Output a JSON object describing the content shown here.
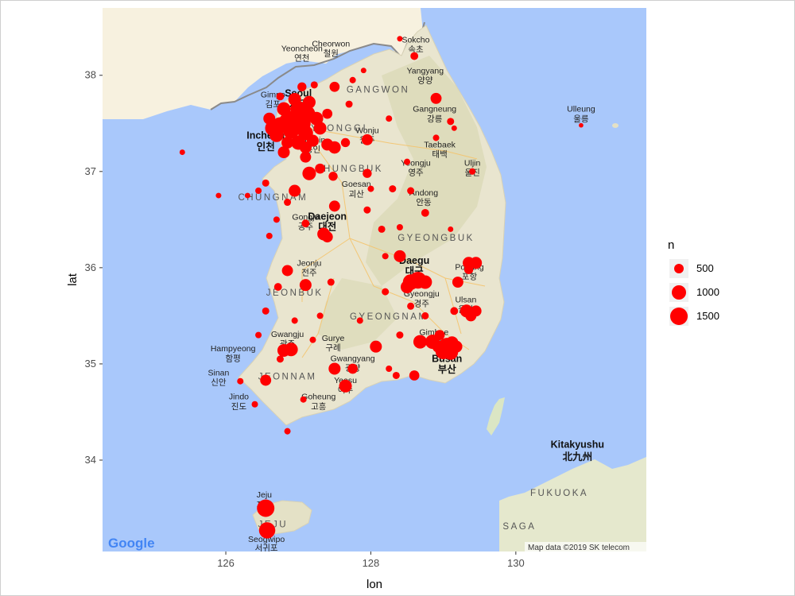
{
  "axes": {
    "xlabel": "lon",
    "ylabel": "lat",
    "x_ticks": [
      "126",
      "128",
      "130"
    ],
    "y_ticks": [
      "34",
      "35",
      "36",
      "37",
      "38"
    ],
    "xlim": [
      124.3,
      131.8
    ],
    "ylim": [
      33.05,
      38.7
    ]
  },
  "legend": {
    "title": "n",
    "entries": [
      {
        "label": "500",
        "value": 500
      },
      {
        "label": "1000",
        "value": 1000
      },
      {
        "label": "1500",
        "value": 1500
      }
    ]
  },
  "basemap": {
    "google_logo": "Google",
    "attribution": "Map data ©2019 SK telecom",
    "place_labels": [
      {
        "text": "Seoul",
        "lon": 127.0,
        "lat": 37.78,
        "bold": true
      },
      {
        "text": "서울",
        "lon": 127.0,
        "lat": 37.66,
        "bold": true
      },
      {
        "text": "Incheon",
        "lon": 126.55,
        "lat": 37.34,
        "bold": true
      },
      {
        "text": "인천",
        "lon": 126.55,
        "lat": 37.22,
        "bold": true
      },
      {
        "text": "Gimpo",
        "lon": 126.65,
        "lat": 37.77
      },
      {
        "text": "김포",
        "lon": 126.65,
        "lat": 37.67
      },
      {
        "text": "Yeoncheon",
        "lon": 127.05,
        "lat": 38.25
      },
      {
        "text": "연천",
        "lon": 127.05,
        "lat": 38.15
      },
      {
        "text": "Cheorwon",
        "lon": 127.45,
        "lat": 38.3
      },
      {
        "text": "철원",
        "lon": 127.45,
        "lat": 38.2
      },
      {
        "text": "Sokcho",
        "lon": 128.62,
        "lat": 38.34
      },
      {
        "text": "속초",
        "lon": 128.62,
        "lat": 38.24
      },
      {
        "text": "Yangyang",
        "lon": 128.75,
        "lat": 38.02
      },
      {
        "text": "양양",
        "lon": 128.75,
        "lat": 37.92
      },
      {
        "text": "Gangneung",
        "lon": 128.88,
        "lat": 37.62
      },
      {
        "text": "강릉",
        "lon": 128.88,
        "lat": 37.52
      },
      {
        "text": "Taebaek",
        "lon": 128.95,
        "lat": 37.25
      },
      {
        "text": "태백",
        "lon": 128.95,
        "lat": 37.15
      },
      {
        "text": "Wonju",
        "lon": 127.95,
        "lat": 37.4
      },
      {
        "text": "원주",
        "lon": 127.95,
        "lat": 37.3
      },
      {
        "text": "Yongin",
        "lon": 127.2,
        "lat": 37.3
      },
      {
        "text": "용인",
        "lon": 127.2,
        "lat": 37.2
      },
      {
        "text": "Yeongju",
        "lon": 128.62,
        "lat": 37.06
      },
      {
        "text": "영주",
        "lon": 128.62,
        "lat": 36.96
      },
      {
        "text": "Uljin",
        "lon": 129.4,
        "lat": 37.06
      },
      {
        "text": "울진",
        "lon": 129.4,
        "lat": 36.96
      },
      {
        "text": "Goesan",
        "lon": 127.8,
        "lat": 36.84
      },
      {
        "text": "괴산",
        "lon": 127.8,
        "lat": 36.74
      },
      {
        "text": "Andong",
        "lon": 128.73,
        "lat": 36.75
      },
      {
        "text": "안동",
        "lon": 128.73,
        "lat": 36.65
      },
      {
        "text": "Daejeon",
        "lon": 127.4,
        "lat": 36.5,
        "bold": true
      },
      {
        "text": "대전",
        "lon": 127.4,
        "lat": 36.39,
        "bold": true
      },
      {
        "text": "Gongju",
        "lon": 127.1,
        "lat": 36.5
      },
      {
        "text": "공주",
        "lon": 127.1,
        "lat": 36.4
      },
      {
        "text": "Daegu",
        "lon": 128.6,
        "lat": 36.04,
        "bold": true
      },
      {
        "text": "대구",
        "lon": 128.6,
        "lat": 35.93,
        "bold": true
      },
      {
        "text": "Pohang",
        "lon": 129.36,
        "lat": 35.98
      },
      {
        "text": "포항",
        "lon": 129.36,
        "lat": 35.88
      },
      {
        "text": "Ulsan",
        "lon": 129.31,
        "lat": 35.64
      },
      {
        "text": "울산",
        "lon": 129.31,
        "lat": 35.54
      },
      {
        "text": "Jeonju",
        "lon": 127.15,
        "lat": 36.02
      },
      {
        "text": "전주",
        "lon": 127.15,
        "lat": 35.92
      },
      {
        "text": "Gyeongju",
        "lon": 128.7,
        "lat": 35.7
      },
      {
        "text": "경주",
        "lon": 128.7,
        "lat": 35.6
      },
      {
        "text": "Gimhae",
        "lon": 128.87,
        "lat": 35.3
      },
      {
        "text": "김해",
        "lon": 128.87,
        "lat": 35.2
      },
      {
        "text": "Busan",
        "lon": 129.05,
        "lat": 35.02,
        "bold": true
      },
      {
        "text": "부산",
        "lon": 129.05,
        "lat": 34.91,
        "bold": true
      },
      {
        "text": "Gwangju",
        "lon": 126.85,
        "lat": 35.28
      },
      {
        "text": "광주",
        "lon": 126.85,
        "lat": 35.18
      },
      {
        "text": "Gurye",
        "lon": 127.48,
        "lat": 35.24
      },
      {
        "text": "구례",
        "lon": 127.48,
        "lat": 35.14
      },
      {
        "text": "Hampyeong",
        "lon": 126.1,
        "lat": 35.13
      },
      {
        "text": "함평",
        "lon": 126.1,
        "lat": 35.03
      },
      {
        "text": "Gwangyang",
        "lon": 127.75,
        "lat": 35.03
      },
      {
        "text": "광양",
        "lon": 127.75,
        "lat": 34.93
      },
      {
        "text": "Sinan",
        "lon": 125.9,
        "lat": 34.88
      },
      {
        "text": "신안",
        "lon": 125.9,
        "lat": 34.78
      },
      {
        "text": "Yeosu",
        "lon": 127.65,
        "lat": 34.8
      },
      {
        "text": "여수",
        "lon": 127.65,
        "lat": 34.7
      },
      {
        "text": "Jindo",
        "lon": 126.18,
        "lat": 34.63
      },
      {
        "text": "진도",
        "lon": 126.18,
        "lat": 34.53
      },
      {
        "text": "Goheung",
        "lon": 127.28,
        "lat": 34.63
      },
      {
        "text": "고흥",
        "lon": 127.28,
        "lat": 34.53
      },
      {
        "text": "Jeju",
        "lon": 126.53,
        "lat": 33.61
      },
      {
        "text": "제주",
        "lon": 126.53,
        "lat": 33.51
      },
      {
        "text": "Seogwipo",
        "lon": 126.56,
        "lat": 33.15
      },
      {
        "text": "서귀포",
        "lon": 126.56,
        "lat": 33.06
      },
      {
        "text": "Ulleung",
        "lon": 130.9,
        "lat": 37.62
      },
      {
        "text": "울릉",
        "lon": 130.9,
        "lat": 37.52
      },
      {
        "text": "Kitakyushu",
        "lon": 130.85,
        "lat": 34.13,
        "bold": true
      },
      {
        "text": "北九州",
        "lon": 130.85,
        "lat": 34.0,
        "bold": true
      }
    ],
    "province_labels": [
      {
        "text": "GANGWON",
        "lon": 128.1,
        "lat": 37.82
      },
      {
        "text": "GYEONGGI",
        "lon": 127.5,
        "lat": 37.42
      },
      {
        "text": "CHUNGBUK",
        "lon": 127.7,
        "lat": 37.0
      },
      {
        "text": "CHUNGNAM",
        "lon": 126.65,
        "lat": 36.7
      },
      {
        "text": "GYEONGBUK",
        "lon": 128.9,
        "lat": 36.28
      },
      {
        "text": "JEONBUK",
        "lon": 126.95,
        "lat": 35.71
      },
      {
        "text": "GYEONGNAM",
        "lon": 128.25,
        "lat": 35.46
      },
      {
        "text": "JEONNAM",
        "lon": 126.85,
        "lat": 34.84
      },
      {
        "text": "JEJU",
        "lon": 126.65,
        "lat": 33.3
      },
      {
        "text": "FUKUOKA",
        "lon": 130.6,
        "lat": 33.63
      },
      {
        "text": "SAGA",
        "lon": 130.05,
        "lat": 33.28
      }
    ]
  },
  "chart_data": {
    "type": "scatter",
    "xlabel": "lon",
    "ylabel": "lat",
    "xlim": [
      124.3,
      131.8
    ],
    "ylim": [
      33.05,
      38.7
    ],
    "size_variable": "n",
    "size_breaks": [
      500,
      1000,
      1500
    ],
    "color": "#ff0000",
    "points": [
      {
        "lon": 126.95,
        "lat": 37.55,
        "n": 1500
      },
      {
        "lon": 127.05,
        "lat": 37.5,
        "n": 1500
      },
      {
        "lon": 126.85,
        "lat": 37.52,
        "n": 1400
      },
      {
        "lon": 126.75,
        "lat": 37.48,
        "n": 1300
      },
      {
        "lon": 127.12,
        "lat": 37.6,
        "n": 1300
      },
      {
        "lon": 127.0,
        "lat": 37.65,
        "n": 1200
      },
      {
        "lon": 126.9,
        "lat": 37.42,
        "n": 1200
      },
      {
        "lon": 127.1,
        "lat": 37.4,
        "n": 1100
      },
      {
        "lon": 126.65,
        "lat": 37.45,
        "n": 1200
      },
      {
        "lon": 126.7,
        "lat": 37.38,
        "n": 1000
      },
      {
        "lon": 127.0,
        "lat": 37.3,
        "n": 1000
      },
      {
        "lon": 126.8,
        "lat": 37.65,
        "n": 900
      },
      {
        "lon": 127.15,
        "lat": 37.72,
        "n": 800
      },
      {
        "lon": 127.25,
        "lat": 37.55,
        "n": 900
      },
      {
        "lon": 126.95,
        "lat": 37.75,
        "n": 800
      },
      {
        "lon": 126.6,
        "lat": 37.55,
        "n": 700
      },
      {
        "lon": 127.3,
        "lat": 37.45,
        "n": 800
      },
      {
        "lon": 127.2,
        "lat": 37.32,
        "n": 700
      },
      {
        "lon": 127.1,
        "lat": 37.25,
        "n": 700
      },
      {
        "lon": 126.85,
        "lat": 37.3,
        "n": 700
      },
      {
        "lon": 126.8,
        "lat": 37.2,
        "n": 700
      },
      {
        "lon": 127.4,
        "lat": 37.28,
        "n": 700
      },
      {
        "lon": 127.1,
        "lat": 37.15,
        "n": 600
      },
      {
        "lon": 127.4,
        "lat": 37.6,
        "n": 500
      },
      {
        "lon": 127.05,
        "lat": 37.88,
        "n": 400
      },
      {
        "lon": 126.75,
        "lat": 37.78,
        "n": 300
      },
      {
        "lon": 127.22,
        "lat": 37.9,
        "n": 250
      },
      {
        "lon": 127.5,
        "lat": 37.88,
        "n": 500
      },
      {
        "lon": 127.7,
        "lat": 37.7,
        "n": 250
      },
      {
        "lon": 127.75,
        "lat": 37.95,
        "n": 200
      },
      {
        "lon": 128.6,
        "lat": 38.2,
        "n": 300
      },
      {
        "lon": 128.4,
        "lat": 38.38,
        "n": 150
      },
      {
        "lon": 128.9,
        "lat": 37.76,
        "n": 600
      },
      {
        "lon": 129.1,
        "lat": 37.52,
        "n": 250
      },
      {
        "lon": 128.9,
        "lat": 37.35,
        "n": 200
      },
      {
        "lon": 129.15,
        "lat": 37.45,
        "n": 150
      },
      {
        "lon": 127.95,
        "lat": 37.33,
        "n": 600
      },
      {
        "lon": 127.65,
        "lat": 37.3,
        "n": 400
      },
      {
        "lon": 127.5,
        "lat": 37.25,
        "n": 750
      },
      {
        "lon": 127.3,
        "lat": 37.03,
        "n": 500
      },
      {
        "lon": 127.15,
        "lat": 36.98,
        "n": 900
      },
      {
        "lon": 126.95,
        "lat": 36.8,
        "n": 700
      },
      {
        "lon": 127.48,
        "lat": 36.95,
        "n": 400
      },
      {
        "lon": 127.95,
        "lat": 36.98,
        "n": 400
      },
      {
        "lon": 128.3,
        "lat": 36.82,
        "n": 250
      },
      {
        "lon": 128.55,
        "lat": 36.8,
        "n": 250
      },
      {
        "lon": 128.75,
        "lat": 36.57,
        "n": 300
      },
      {
        "lon": 129.4,
        "lat": 37.0,
        "n": 200
      },
      {
        "lon": 126.55,
        "lat": 36.88,
        "n": 250
      },
      {
        "lon": 126.45,
        "lat": 36.8,
        "n": 200
      },
      {
        "lon": 126.3,
        "lat": 36.75,
        "n": 150
      },
      {
        "lon": 126.85,
        "lat": 36.68,
        "n": 250
      },
      {
        "lon": 127.5,
        "lat": 36.64,
        "n": 600
      },
      {
        "lon": 127.35,
        "lat": 36.35,
        "n": 800
      },
      {
        "lon": 127.4,
        "lat": 36.32,
        "n": 600
      },
      {
        "lon": 127.1,
        "lat": 36.46,
        "n": 300
      },
      {
        "lon": 126.7,
        "lat": 36.5,
        "n": 200
      },
      {
        "lon": 126.6,
        "lat": 36.33,
        "n": 200
      },
      {
        "lon": 128.15,
        "lat": 36.4,
        "n": 250
      },
      {
        "lon": 128.4,
        "lat": 36.42,
        "n": 200
      },
      {
        "lon": 129.1,
        "lat": 36.4,
        "n": 150
      },
      {
        "lon": 128.2,
        "lat": 36.12,
        "n": 200
      },
      {
        "lon": 128.4,
        "lat": 36.12,
        "n": 700
      },
      {
        "lon": 128.65,
        "lat": 35.87,
        "n": 1400
      },
      {
        "lon": 128.55,
        "lat": 35.85,
        "n": 1200
      },
      {
        "lon": 128.75,
        "lat": 35.85,
        "n": 900
      },
      {
        "lon": 128.5,
        "lat": 35.8,
        "n": 800
      },
      {
        "lon": 129.35,
        "lat": 36.05,
        "n": 700
      },
      {
        "lon": 129.35,
        "lat": 35.98,
        "n": 400
      },
      {
        "lon": 129.2,
        "lat": 35.85,
        "n": 600
      },
      {
        "lon": 129.32,
        "lat": 35.55,
        "n": 800
      },
      {
        "lon": 129.38,
        "lat": 35.5,
        "n": 600
      },
      {
        "lon": 129.15,
        "lat": 35.55,
        "n": 300
      },
      {
        "lon": 128.75,
        "lat": 35.5,
        "n": 250
      },
      {
        "lon": 128.55,
        "lat": 35.6,
        "n": 250
      },
      {
        "lon": 126.85,
        "lat": 35.97,
        "n": 600
      },
      {
        "lon": 127.1,
        "lat": 35.82,
        "n": 700
      },
      {
        "lon": 126.72,
        "lat": 35.8,
        "n": 300
      },
      {
        "lon": 127.45,
        "lat": 35.85,
        "n": 250
      },
      {
        "lon": 128.07,
        "lat": 35.18,
        "n": 700
      },
      {
        "lon": 128.68,
        "lat": 35.23,
        "n": 900
      },
      {
        "lon": 128.85,
        "lat": 35.23,
        "n": 1000
      },
      {
        "lon": 129.05,
        "lat": 35.18,
        "n": 1500
      },
      {
        "lon": 129.0,
        "lat": 35.13,
        "n": 1200
      },
      {
        "lon": 129.1,
        "lat": 35.12,
        "n": 1100
      },
      {
        "lon": 129.12,
        "lat": 35.22,
        "n": 800
      },
      {
        "lon": 128.93,
        "lat": 35.18,
        "n": 700
      },
      {
        "lon": 129.18,
        "lat": 35.18,
        "n": 700
      },
      {
        "lon": 128.95,
        "lat": 35.3,
        "n": 500
      },
      {
        "lon": 126.9,
        "lat": 35.15,
        "n": 900
      },
      {
        "lon": 126.8,
        "lat": 35.14,
        "n": 800
      },
      {
        "lon": 126.75,
        "lat": 35.05,
        "n": 250
      },
      {
        "lon": 127.5,
        "lat": 34.95,
        "n": 700
      },
      {
        "lon": 127.75,
        "lat": 34.95,
        "n": 500
      },
      {
        "lon": 127.65,
        "lat": 34.77,
        "n": 800
      },
      {
        "lon": 128.35,
        "lat": 34.88,
        "n": 250
      },
      {
        "lon": 128.6,
        "lat": 34.88,
        "n": 500
      },
      {
        "lon": 126.55,
        "lat": 34.83,
        "n": 600
      },
      {
        "lon": 126.2,
        "lat": 34.82,
        "n": 200
      },
      {
        "lon": 126.4,
        "lat": 34.58,
        "n": 200
      },
      {
        "lon": 127.07,
        "lat": 34.63,
        "n": 200
      },
      {
        "lon": 126.85,
        "lat": 34.3,
        "n": 200
      },
      {
        "lon": 126.55,
        "lat": 33.5,
        "n": 1500
      },
      {
        "lon": 126.57,
        "lat": 33.27,
        "n": 1300
      },
      {
        "lon": 130.9,
        "lat": 37.48,
        "n": 100
      },
      {
        "lon": 125.4,
        "lat": 37.2,
        "n": 150
      },
      {
        "lon": 125.9,
        "lat": 36.75,
        "n": 150
      },
      {
        "lon": 129.45,
        "lat": 35.55,
        "n": 600
      },
      {
        "lon": 129.45,
        "lat": 36.05,
        "n": 700
      },
      {
        "lon": 128.2,
        "lat": 35.75,
        "n": 250
      },
      {
        "lon": 127.85,
        "lat": 35.45,
        "n": 200
      },
      {
        "lon": 127.3,
        "lat": 35.5,
        "n": 200
      },
      {
        "lon": 126.55,
        "lat": 35.55,
        "n": 250
      },
      {
        "lon": 126.95,
        "lat": 35.45,
        "n": 200
      },
      {
        "lon": 127.2,
        "lat": 35.25,
        "n": 200
      },
      {
        "lon": 126.45,
        "lat": 35.3,
        "n": 200
      },
      {
        "lon": 127.95,
        "lat": 36.6,
        "n": 250
      },
      {
        "lon": 128.0,
        "lat": 36.82,
        "n": 200
      },
      {
        "lon": 128.5,
        "lat": 37.1,
        "n": 200
      },
      {
        "lon": 128.25,
        "lat": 37.55,
        "n": 200
      },
      {
        "lon": 127.9,
        "lat": 38.05,
        "n": 150
      },
      {
        "lon": 128.4,
        "lat": 35.3,
        "n": 250
      },
      {
        "lon": 128.25,
        "lat": 34.95,
        "n": 200
      }
    ]
  }
}
